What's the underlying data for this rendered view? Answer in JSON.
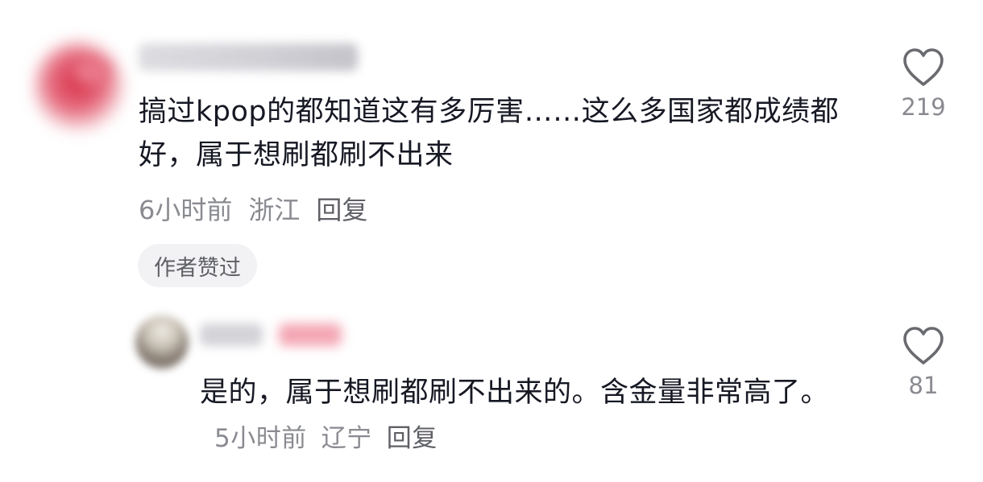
{
  "comment": {
    "text": "搞过kpop的都知道这有多厉害……这么多国家都成绩都好，属于想刷都刷不出来",
    "time": "6小时前",
    "location": "浙江",
    "reply_label": "回复",
    "author_liked": "作者赞过",
    "like_icon": "heart-outline-icon",
    "like_count": "219"
  },
  "reply": {
    "text": "是的，属于想刷都刷不出来的。含金量非常高了。",
    "time": "5小时前",
    "location": "辽宁",
    "reply_label": "回复",
    "like_icon": "heart-outline-icon",
    "like_count": "81"
  },
  "colors": {
    "text_primary": "#161823",
    "text_secondary": "#8a8b91",
    "chip_background": "#f2f2f4"
  }
}
